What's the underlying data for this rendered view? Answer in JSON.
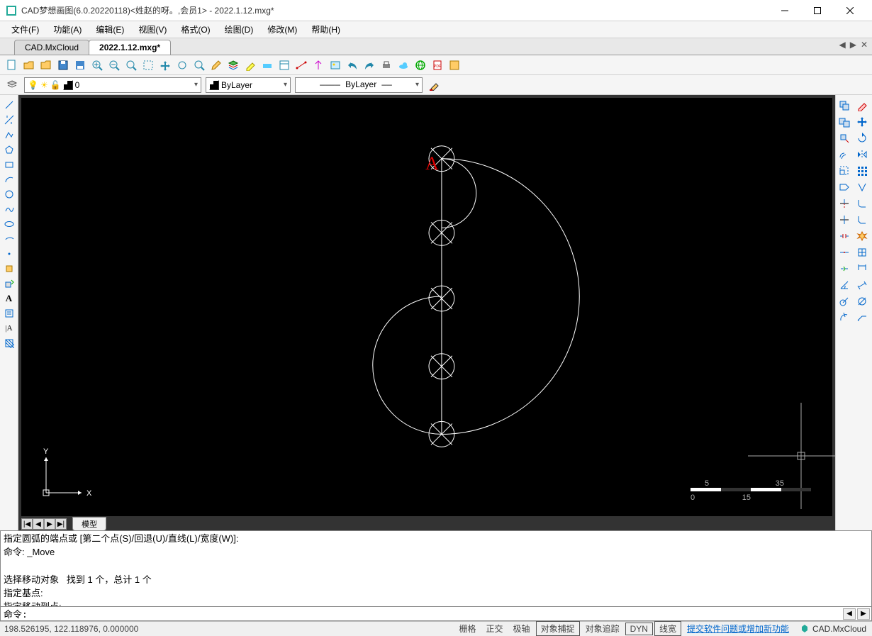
{
  "window": {
    "title": "CAD梦想画图(6.0.20220118)<姓赵的呀。,会员1> - 2022.1.12.mxg*"
  },
  "menus": {
    "file": "文件(F)",
    "func": "功能(A)",
    "edit": "编辑(E)",
    "view": "视图(V)",
    "format": "格式(O)",
    "draw": "绘图(D)",
    "modify": "修改(M)",
    "help": "帮助(H)"
  },
  "tabs": {
    "t1": "CAD.MxCloud",
    "t2": "2022.1.12.mxg*"
  },
  "layer": {
    "current": "0",
    "color_label": "ByLayer",
    "ltype_label": "ByLayer"
  },
  "canvas": {
    "label_a": "A",
    "ucs_x": "X",
    "ucs_y": "Y",
    "scale_left": "5",
    "scale_right": "35",
    "scale_b0": "0",
    "scale_b1": "15",
    "model_tab": "模型"
  },
  "cmd": {
    "log_l1": "指定圆弧的端点或 [第二个点(S)/回退(U)/直线(L)/宽度(W)]:",
    "log_l2": "命令: _Move",
    "log_l3": "",
    "log_l4": "选择移动对象   找到 1 个，总计 1 个",
    "log_l5": "指定基点:",
    "log_l6": "指定移动到点:",
    "prompt": "命令:",
    "input": ""
  },
  "status": {
    "coords": "198.526195,  122.118976,  0.000000",
    "snap": "栅格",
    "ortho": "正交",
    "polar": "极轴",
    "osnap": "对象捕捉",
    "otrack": "对象追踪",
    "dyn": "DYN",
    "lwt": "线宽",
    "feedback": "提交软件问题或增加新功能",
    "brand": "CAD.MxCloud"
  }
}
